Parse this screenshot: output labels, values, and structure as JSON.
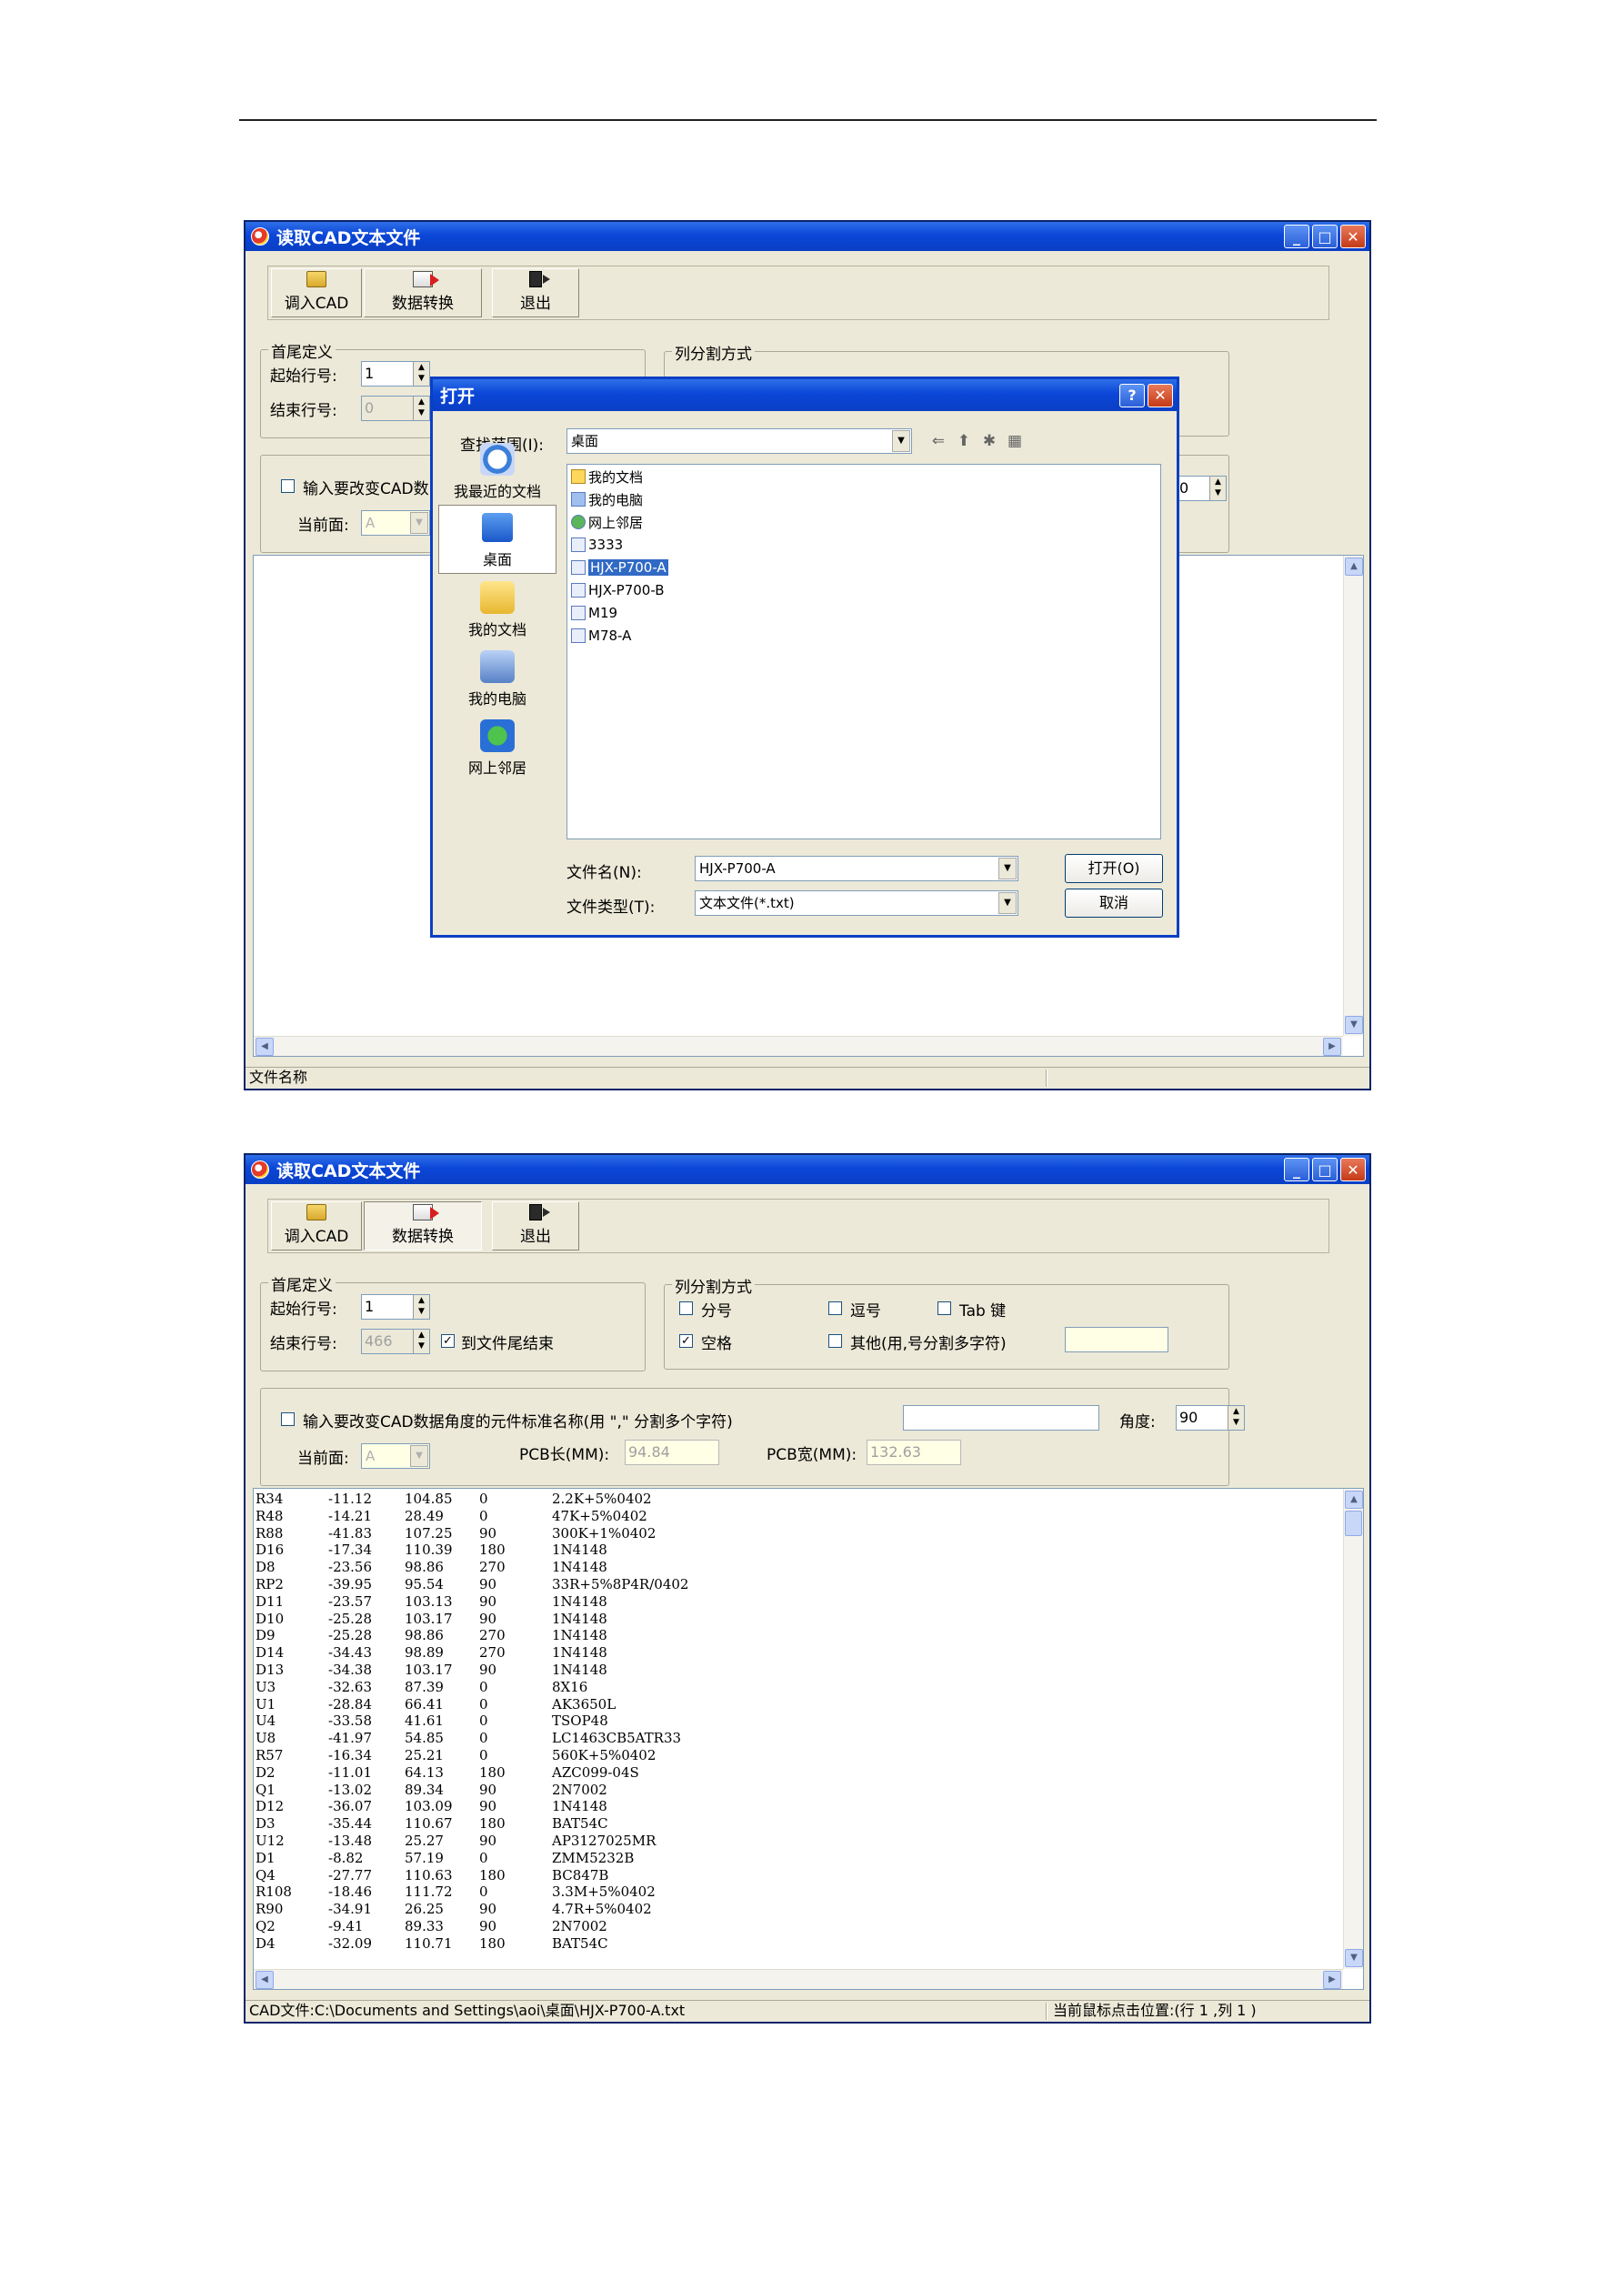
{
  "window_title": "读取CAD文本文件",
  "toolbar": {
    "load_cad": "调入CAD",
    "convert": "数据转换",
    "exit": "退出"
  },
  "head_tail": {
    "group": "首尾定义",
    "start_label": "起始行号:",
    "start_value": "1",
    "end_label": "结束行号:",
    "end_value_1": "0",
    "end_value_2": "466",
    "to_end": "到文件尾结束"
  },
  "split": {
    "group": "列分割方式",
    "semicolon": "分号",
    "comma": "逗号",
    "tab": "Tab 键",
    "space": "空格",
    "other": "其他(用,号分割多字符)",
    "other_value": ""
  },
  "angle_section": {
    "checkbox_label": "输入要改变CAD数据角度的元件标准名称(用 \",\" 分割多个字符)",
    "checkbox_label_short": "输入要改变CAD数",
    "names_value": "",
    "angle_label": "角度:",
    "angle_value": "90",
    "angle_value_partial": "0",
    "current_side_label": "当前面:",
    "current_side_value": "A",
    "pcb_len_label": "PCB长(MM):",
    "pcb_len_value": "94.84",
    "pcb_wid_label": "PCB宽(MM):",
    "pcb_wid_value": "132.63"
  },
  "status": {
    "file_name_label": "文件名称",
    "cad_file": "CAD文件:C:\\Documents and Settings\\aoi\\桌面\\HJX-P700-A.txt",
    "cursor_pos": "当前鼠标点击位置:(行 1 ,列 1 )"
  },
  "dialog": {
    "title": "打开",
    "look_in_label": "查找范围(I):",
    "look_in_value": "桌面",
    "places": [
      "我最近的文档",
      "桌面",
      "我的文档",
      "我的电脑",
      "网上邻居"
    ],
    "files": [
      {
        "name": "我的文档",
        "icon": "folder-icon"
      },
      {
        "name": "我的电脑",
        "icon": "computer-icon"
      },
      {
        "name": "网上邻居",
        "icon": "network-icon"
      },
      {
        "name": "3333",
        "icon": "text-file-icon"
      },
      {
        "name": "HJX-P700-A",
        "icon": "text-file-icon",
        "selected": true
      },
      {
        "name": "HJX-P700-B",
        "icon": "text-file-icon"
      },
      {
        "name": "M19",
        "icon": "text-file-icon"
      },
      {
        "name": "M78-A",
        "icon": "text-file-icon"
      }
    ],
    "file_name_label": "文件名(N):",
    "file_name_value": "HJX-P700-A",
    "file_type_label": "文件类型(T):",
    "file_type_value": "文本文件(*.txt)",
    "open_button": "打开(O)",
    "cancel_button": "取消"
  },
  "data_rows": [
    [
      "R34",
      "-11.12",
      "104.85",
      "0",
      "2.2K+5%0402"
    ],
    [
      "R48",
      "-14.21",
      "28.49",
      "0",
      "47K+5%0402"
    ],
    [
      "R88",
      "-41.83",
      "107.25",
      "90",
      "300K+1%0402"
    ],
    [
      "D16",
      "-17.34",
      "110.39",
      "180",
      "1N4148"
    ],
    [
      "D8",
      "-23.56",
      "98.86",
      "270",
      "1N4148"
    ],
    [
      "RP2",
      "-39.95",
      "95.54",
      "90",
      "33R+5%8P4R/0402"
    ],
    [
      "D11",
      "-23.57",
      "103.13",
      "90",
      "1N4148"
    ],
    [
      "D10",
      "-25.28",
      "103.17",
      "90",
      "1N4148"
    ],
    [
      "D9",
      "-25.28",
      "98.86",
      "270",
      "1N4148"
    ],
    [
      "D14",
      "-34.43",
      "98.89",
      "270",
      "1N4148"
    ],
    [
      "D13",
      "-34.38",
      "103.17",
      "90",
      "1N4148"
    ],
    [
      "U3",
      "-32.63",
      "87.39",
      "0",
      "8X16"
    ],
    [
      "U1",
      "-28.84",
      "66.41",
      "0",
      "AK3650L"
    ],
    [
      "U4",
      "-33.58",
      "41.61",
      "0",
      "TSOP48"
    ],
    [
      "U8",
      "-41.97",
      "54.85",
      "0",
      "LC1463CB5ATR33"
    ],
    [
      "R57",
      "-16.34",
      "25.21",
      "0",
      "560K+5%0402"
    ],
    [
      "D2",
      "-11.01",
      "64.13",
      "180",
      "AZC099-04S"
    ],
    [
      "Q1",
      "-13.02",
      "89.34",
      "90",
      "2N7002"
    ],
    [
      "D12",
      "-36.07",
      "103.09",
      "90",
      "1N4148"
    ],
    [
      "D3",
      "-35.44",
      "110.67",
      "180",
      "BAT54C"
    ],
    [
      "U12",
      "-13.48",
      "25.27",
      "90",
      "AP3127025MR"
    ],
    [
      "D1",
      "-8.82",
      "57.19",
      "0",
      "ZMM5232B"
    ],
    [
      "Q4",
      "-27.77",
      "110.63",
      "180",
      "BC847B"
    ],
    [
      "R108",
      "-18.46",
      "111.72",
      "0",
      "3.3M+5%0402"
    ],
    [
      "R90",
      "-34.91",
      "26.25",
      "90",
      "4.7R+5%0402"
    ],
    [
      "Q2",
      "-9.41",
      "89.33",
      "90",
      "2N7002"
    ],
    [
      "D4",
      "-32.09",
      "110.71",
      "180",
      "BAT54C"
    ]
  ]
}
